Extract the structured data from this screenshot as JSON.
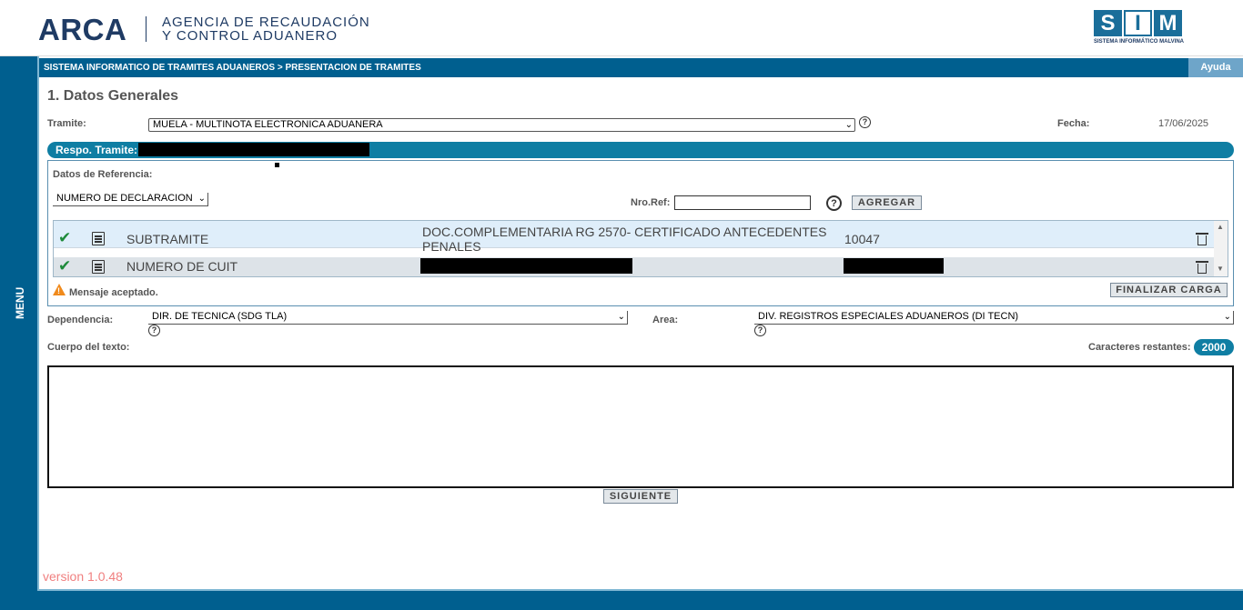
{
  "header": {
    "logo_text": "ARCA",
    "agency_line1": "AGENCIA DE RECAUDACIÓN",
    "agency_line2": "Y CONTROL ADUANERO",
    "sim_letters": [
      "S",
      "I",
      "M"
    ],
    "sim_caption": "SISTEMA INFORMÁTICO MALVINA"
  },
  "menu": {
    "label": "MENU"
  },
  "breadcrumb": "SISTEMA INFORMATICO DE TRAMITES ADUANEROS > PRESENTACION DE TRAMITES",
  "help_tab": "Ayuda",
  "section_title": "1. Datos Generales",
  "tramite": {
    "label": "Tramite:",
    "selected": "MUELA - MULTINOTA ELECTRONICA ADUANERA",
    "fecha_label": "Fecha:",
    "fecha_value": "17/06/2025"
  },
  "respo": {
    "label": "Respo. Tramite:"
  },
  "referencia": {
    "label": "Datos de Referencia:",
    "type_selected": "NUMERO DE DECLARACION",
    "nro_ref_label": "Nro.Ref:",
    "nro_ref_value": "",
    "add_button": "AGREGAR"
  },
  "ref_rows": [
    {
      "type": "SUBTRAMITE",
      "description": "DOC.COMPLEMENTARIA RG 2570- CERTIFICADO ANTECEDENTES PENALES",
      "value": "10047"
    },
    {
      "type": "NUMERO DE CUIT",
      "description": "",
      "value": ""
    }
  ],
  "status_message": "Mensaje aceptado.",
  "finalize_button": "FINALIZAR CARGA",
  "dependencia": {
    "label": "Dependencia:",
    "selected": "DIR. DE TECNICA (SDG TLA)"
  },
  "area": {
    "label": "Area:",
    "selected": "DIV. REGISTROS ESPECIALES ADUANEROS (DI TECN)"
  },
  "cuerpo": {
    "label": "Cuerpo del texto:",
    "value": ""
  },
  "caracteres": {
    "label": "Caracteres restantes:",
    "value": "2000"
  },
  "next_button": "SIGUIENTE",
  "version": "version 1.0.48",
  "colors": {
    "primary": "#005f8f",
    "accent": "#0f7ea3",
    "check": "#1e8a3a",
    "warning": "#f08a1c"
  }
}
